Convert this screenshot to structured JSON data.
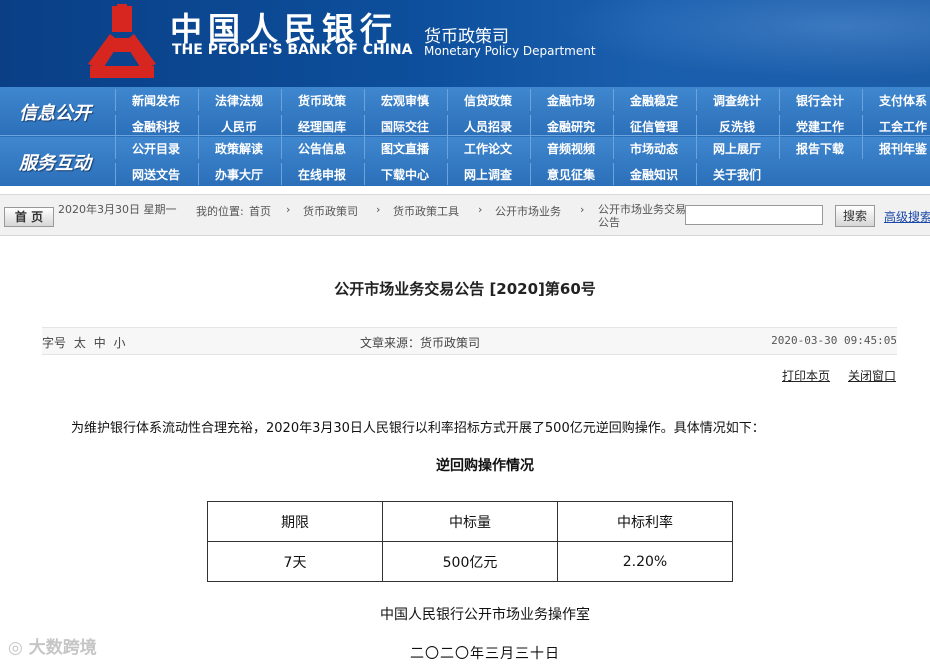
{
  "header": {
    "cn_title": "中国人民银行",
    "en_title": "THE PEOPLE'S BANK OF CHINA",
    "dept_cn": "货币政策司",
    "dept_en": "Monetary Policy Department",
    "colors": {
      "primary": "#0d4f9c",
      "logo_red": "#d7261f"
    }
  },
  "nav": {
    "section1": "信息公开",
    "section2": "服务互动",
    "row1": [
      "新闻发布",
      "法律法规",
      "货币政策",
      "宏观审慎",
      "信贷政策",
      "金融市场",
      "金融稳定",
      "调查统计",
      "银行会计",
      "支付体系"
    ],
    "row2": [
      "金融科技",
      "人民币",
      "经理国库",
      "国际交往",
      "人员招录",
      "金融研究",
      "征信管理",
      "反洗钱",
      "党建工作",
      "工会工作"
    ],
    "row3": [
      "公开目录",
      "政策解读",
      "公告信息",
      "图文直播",
      "工作论文",
      "音频视频",
      "市场动态",
      "网上展厅",
      "报告下载",
      "报刊年鉴"
    ],
    "row4": [
      "网送文告",
      "办事大厅",
      "在线申报",
      "下载中心",
      "网上调查",
      "意见征集",
      "金融知识",
      "关于我们"
    ]
  },
  "crumbbar": {
    "home_label": "首 页",
    "date": "2020年3月30日 星期一",
    "location_label": "我的位置:",
    "crumbs": [
      "首页",
      "货币政策司",
      "货币政策工具",
      "公开市场业务",
      "公开市场业务交易公告"
    ],
    "search_placeholder": "",
    "search_label": "搜索",
    "advanced_label": "高级搜索"
  },
  "article": {
    "title": "公开市场业务交易公告 [2020]第60号",
    "fontsize_label": "字号",
    "fontsize_options": [
      "太",
      "中",
      "小"
    ],
    "source": "文章来源：货币政策司",
    "timestamp": "2020-03-30 09:45:05",
    "print_label": "打印本页",
    "close_label": "关闭窗口",
    "intro": "为维护银行体系流动性合理充裕，2020年3月30日人民银行以利率招标方式开展了500亿元逆回购操作。具体情况如下：",
    "table_title": "逆回购操作情况",
    "table": {
      "headers": [
        "期限",
        "中标量",
        "中标利率"
      ],
      "rows": [
        [
          "7天",
          "500亿元",
          "2.20%"
        ]
      ]
    },
    "footer_org": "中国人民银行公开市场业务操作室",
    "footer_date": "二〇二〇年三月三十日"
  },
  "watermark": "大数跨境"
}
